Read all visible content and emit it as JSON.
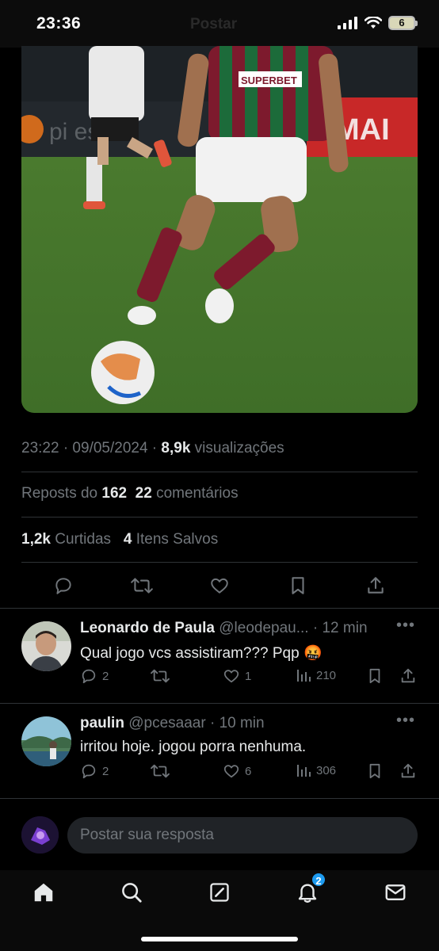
{
  "status": {
    "time": "23:36",
    "battery": "6",
    "header_ghost": "Postar"
  },
  "post": {
    "timestamp": "23:22 · 09/05/2024 · ",
    "views_count": "8,9k",
    "views_label": " visualizações",
    "reposts_label": "Reposts do ",
    "reposts_count": "162",
    "comments_count": "22",
    "comments_label": " comentários",
    "likes_count": "1,2k",
    "likes_label": " Curtidas",
    "saves_count": "4",
    "saves_label": " Itens Salvos",
    "jersey_sponsor": "SUPERBET"
  },
  "replies": [
    {
      "name": "Leonardo de Paula",
      "handle": "@leodepau...",
      "time": " · 12 min",
      "text": "Qual jogo vcs assistiram??? Pqp 🤬",
      "replies": "2",
      "likes": "1",
      "views": "210"
    },
    {
      "name": "paulin",
      "handle": "@pcesaaar",
      "time": " · 10 min",
      "text": "irritou hoje. jogou porra nenhuma.",
      "replies": "2",
      "likes": "6",
      "views": "306"
    }
  ],
  "compose": {
    "placeholder": "Postar sua resposta"
  },
  "tabs": {
    "notifications_badge": "2"
  },
  "colors": {
    "accent": "#1d9bf0",
    "muted": "#71767b",
    "divider": "#2f3336"
  },
  "icons": [
    "reply-icon",
    "repost-icon",
    "like-icon",
    "bookmark-icon",
    "share-icon",
    "views-icon",
    "more-icon",
    "home-icon",
    "search-icon",
    "grok-icon",
    "notifications-icon",
    "messages-icon"
  ]
}
